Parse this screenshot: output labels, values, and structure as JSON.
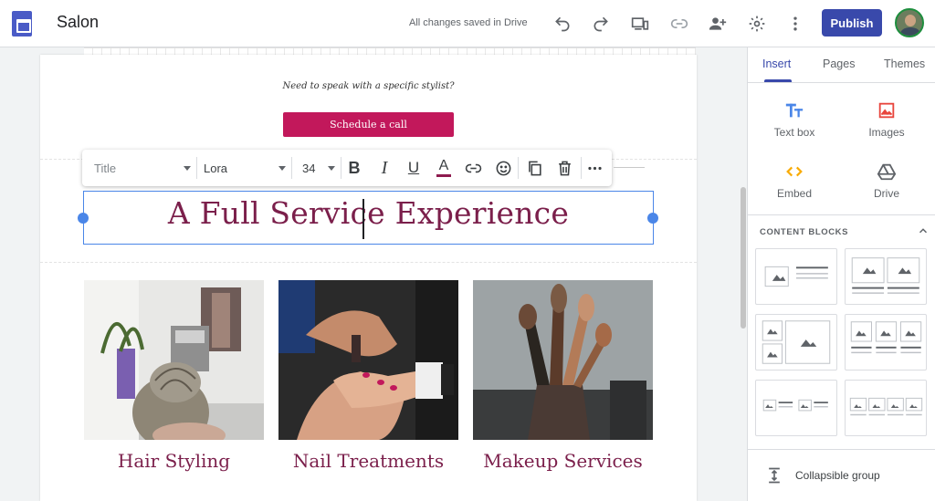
{
  "header": {
    "app_name": "Salon",
    "save_status": "All changes saved in Drive",
    "publish_label": "Publish",
    "icons": [
      "undo-icon",
      "redo-icon",
      "preview-icon",
      "link-icon",
      "share-icon",
      "settings-icon",
      "more-icon"
    ]
  },
  "page": {
    "stylist_note": "Need to speak with a specific stylist?",
    "schedule_button": "Schedule a call",
    "heading": "A Full Service Experience",
    "services": [
      {
        "label": "Hair Styling"
      },
      {
        "label": "Nail Treatments"
      },
      {
        "label": "Makeup Services"
      }
    ]
  },
  "format_toolbar": {
    "style_value": "Title",
    "font_value": "Lora",
    "size_value": "34",
    "bold_glyph": "B",
    "italic_glyph": "I",
    "underline_glyph": "U",
    "color_glyph": "A",
    "text_color": "#8e1b4f"
  },
  "panel": {
    "tabs": [
      {
        "label": "Insert",
        "active": true
      },
      {
        "label": "Pages",
        "active": false
      },
      {
        "label": "Themes",
        "active": false
      }
    ],
    "insert_items": [
      {
        "label": "Text box",
        "icon": "text-box-icon"
      },
      {
        "label": "Images",
        "icon": "image-icon"
      },
      {
        "label": "Embed",
        "icon": "embed-icon"
      },
      {
        "label": "Drive",
        "icon": "drive-icon"
      }
    ],
    "content_blocks_title": "CONTENT BLOCKS",
    "collapsible_group_label": "Collapsible group"
  },
  "colors": {
    "accent": "#3949ab",
    "brand_pink": "#c2185b",
    "heading_color": "#7b1f4b",
    "selection_blue": "#4a86e8"
  }
}
